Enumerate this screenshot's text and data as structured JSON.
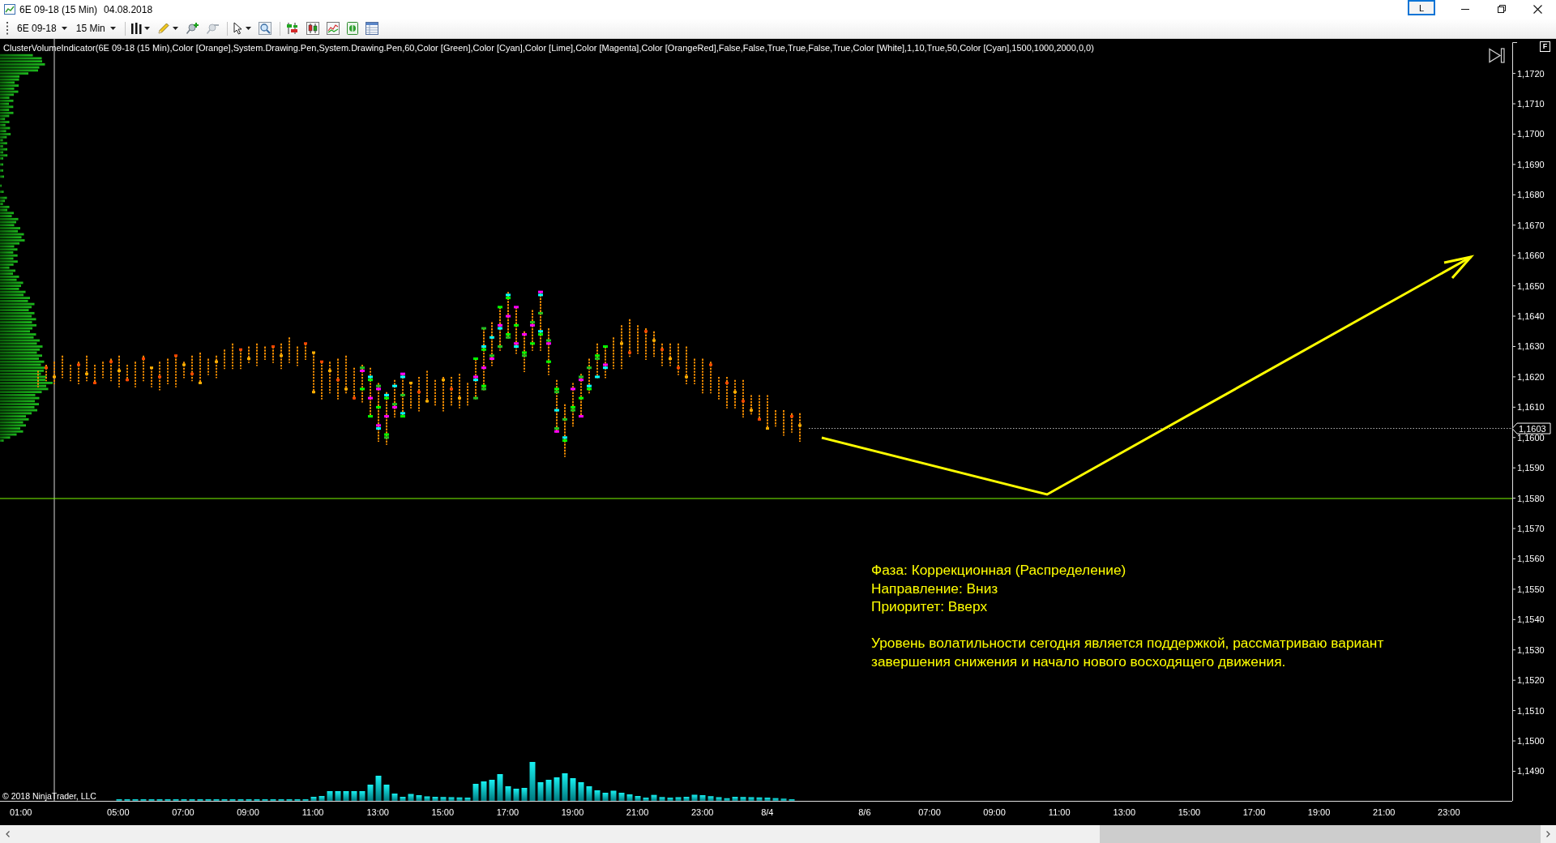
{
  "window": {
    "title": "6E 09-18 (15 Min)",
    "date": "04.08.2018",
    "link_button": "L"
  },
  "toolbar": {
    "instrument": "6E 09-18",
    "interval": "15 Min"
  },
  "chart": {
    "indicator_label": "ClusterVolumeIndicator(6E 09-18 (15 Min),Color [Orange],System.Drawing.Pen,System.Drawing.Pen,60,Color [Green],Color [Cyan],Color [Lime],Color [Magenta],Color [OrangeRed],False,False,True,True,False,True,Color [White],1,10,True,50,Color [Cyan],1500,1000,2000,0,0)",
    "corner_button": "F",
    "price_labels": [
      "1,1720",
      "1,1710",
      "1,1700",
      "1,1690",
      "1,1680",
      "1,1670",
      "1,1660",
      "1,1650",
      "1,1640",
      "1,1630",
      "1,1620",
      "1,1610",
      "1,1600",
      "1,1590",
      "1,1580",
      "1,1570",
      "1,1560",
      "1,1550",
      "1,1540",
      "1,1530",
      "1,1520",
      "1,1510",
      "1,1500",
      "1,1490"
    ],
    "last_price": "1,1603",
    "time_labels": [
      "01:00",
      "05:00",
      "07:00",
      "09:00",
      "11:00",
      "13:00",
      "15:00",
      "17:00",
      "19:00",
      "21:00",
      "23:00",
      "8/4",
      "8/6",
      "07:00",
      "09:00",
      "11:00",
      "13:00",
      "15:00",
      "17:00",
      "19:00",
      "21:00",
      "23:00"
    ],
    "copyright": "© 2018 NinjaTrader, LLC",
    "annotation": {
      "lines": [
        "Фаза: Коррекционная (Распределение)",
        "Направление: Вниз",
        "Приоритет: Вверх"
      ],
      "note": "Уровень волатильности сегодня является поддержкой, рассматриваю вариант завершения снижения и начало нового восходящего движения."
    }
  }
}
